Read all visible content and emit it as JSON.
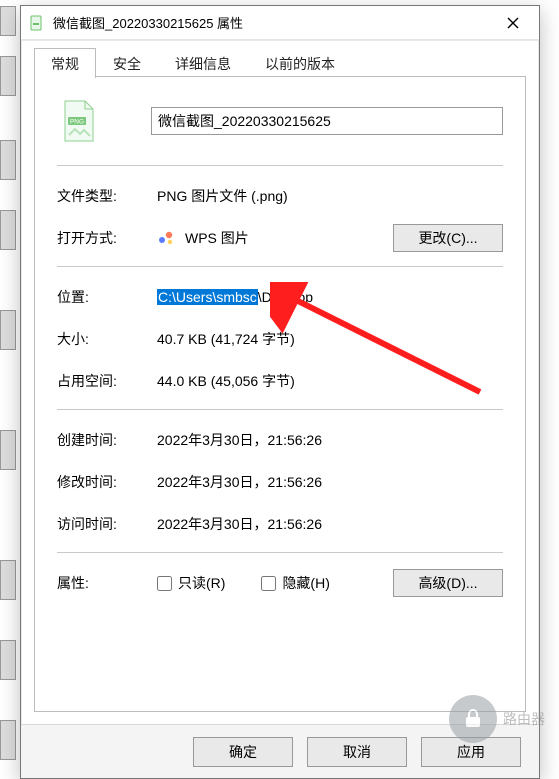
{
  "window": {
    "title": "微信截图_20220330215625 属性"
  },
  "tabs": {
    "general": "常规",
    "security": "安全",
    "details": "详细信息",
    "previous": "以前的版本"
  },
  "filename": {
    "value": "微信截图_20220330215625"
  },
  "labels": {
    "filetype": "文件类型:",
    "opens_with": "打开方式:",
    "location": "位置:",
    "size": "大小:",
    "size_on_disk": "占用空间:",
    "created": "创建时间:",
    "modified": "修改时间:",
    "accessed": "访问时间:",
    "attributes": "属性:"
  },
  "values": {
    "filetype": "PNG 图片文件 (.png)",
    "opens_with": "WPS 图片",
    "location_sel": "C:\\Users\\smbsc",
    "location_rest": "\\Desktop",
    "size": "40.7 KB (41,724 字节)",
    "size_on_disk": "44.0 KB (45,056 字节)",
    "created": "2022年3月30日，21:56:26",
    "modified": "2022年3月30日，21:56:26",
    "accessed": "2022年3月30日，21:56:26"
  },
  "buttons": {
    "change": "更改(C)...",
    "advanced": "高级(D)...",
    "ok": "确定",
    "cancel": "取消",
    "apply": "应用"
  },
  "checkboxes": {
    "readonly": "只读(R)",
    "hidden": "隐藏(H)"
  },
  "watermark": {
    "text": "路由器"
  }
}
